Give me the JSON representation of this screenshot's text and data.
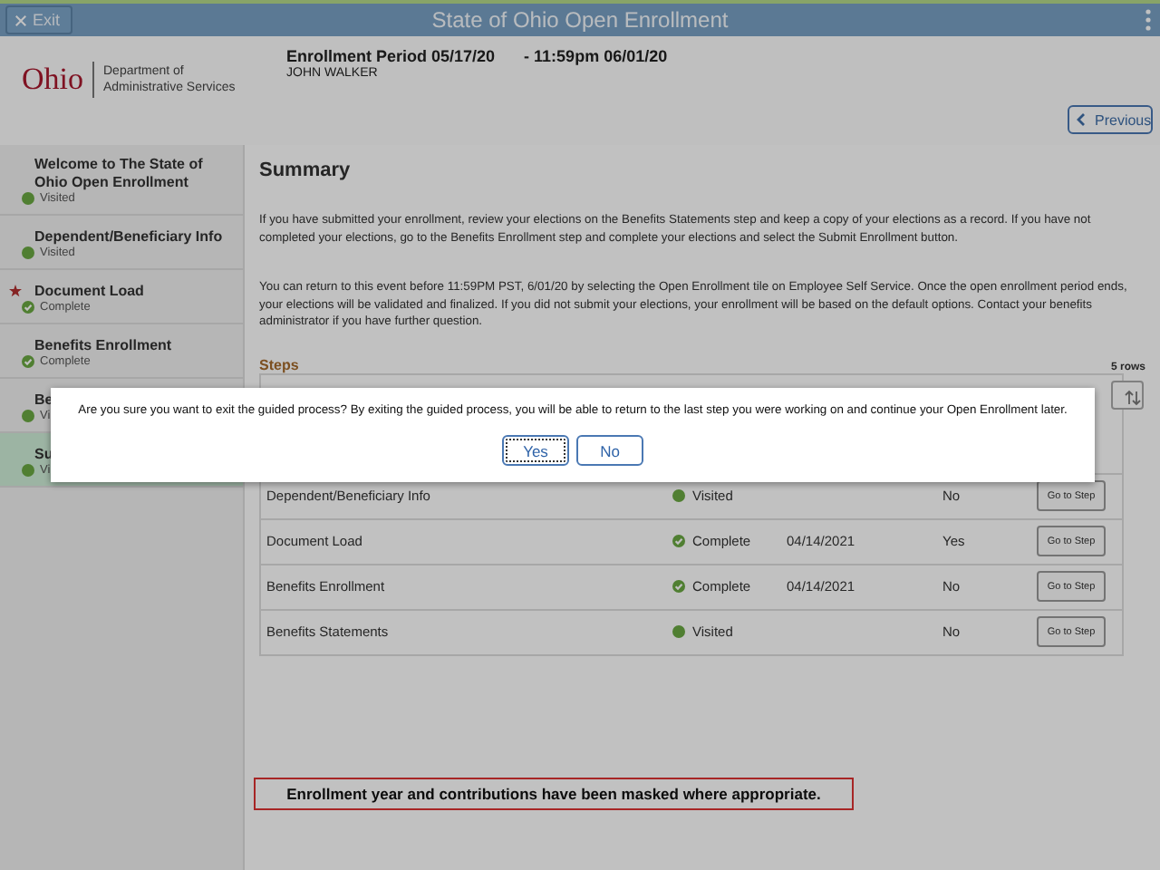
{
  "top_bar": {
    "exit_button": "Exit",
    "title": "State of Ohio Open Enrollment"
  },
  "logo": {
    "name": "Ohio",
    "department": "Department of Administrative Services"
  },
  "enrollment": {
    "period_start": "Enrollment Period 05/17/20",
    "period_end": "- 11:59pm 06/01/20",
    "employee": "JOHN WALKER"
  },
  "previous_button": "Previous",
  "sidebar": {
    "items": [
      {
        "label": "Welcome to The State of Ohio Open Enrollment",
        "status": "Visited",
        "kind": "visited",
        "required": false,
        "selected": false
      },
      {
        "label": "Dependent/Beneficiary Info",
        "status": "Visited",
        "kind": "visited",
        "required": false,
        "selected": false
      },
      {
        "label": "Document Load",
        "status": "Complete",
        "kind": "complete",
        "required": true,
        "selected": false
      },
      {
        "label": "Benefits Enrollment",
        "status": "Complete",
        "kind": "complete",
        "required": false,
        "selected": false
      },
      {
        "label": "Be",
        "status": "Vi",
        "kind": "visited",
        "required": false,
        "selected": false
      },
      {
        "label": "Su",
        "status": "Vi",
        "kind": "visited",
        "required": false,
        "selected": true
      }
    ]
  },
  "summary": {
    "title": "Summary",
    "paragraphs": [
      "If you have submitted your enrollment, review your elections on the Benefits Statements step and keep a copy of your elections as a record. If you have not completed your elections, go to the Benefits Enrollment step and complete your elections and select the Submit Enrollment button.",
      "You can return to this event before 11:59PM PST, 6/01/20 by selecting the Open Enrollment tile on Employee Self Service. Once the open enrollment period ends, your elections will be validated and finalized. If you did not submit your elections, your enrollment will be based on the default options.  Contact your benefits administrator if you have further question."
    ]
  },
  "steps": {
    "title": "Steps",
    "row_count": "5 rows",
    "rows": [
      {
        "step": "Dependent/Beneficiary Info",
        "status": "Visited",
        "kind": "visited",
        "required": "No",
        "button": "Go to Step"
      },
      {
        "step": "Document Load",
        "status": "Complete",
        "kind": "complete",
        "date": "04/14/2021",
        "required": "Yes",
        "button": "Go to Step"
      },
      {
        "step": "Benefits Enrollment",
        "status": "Complete",
        "kind": "complete",
        "date": "04/14/2021",
        "required": "No",
        "button": "Go to Step"
      },
      {
        "step": "Benefits Statements",
        "status": "Visited",
        "kind": "visited",
        "required": "No",
        "button": "Go to Step"
      }
    ]
  },
  "note": "Enrollment year and contributions have been masked where appropriate.",
  "dialog": {
    "message": "Are you sure you want to exit the guided process? By exiting the guided process, you will be able to return to the last step you were working on and continue your Open Enrollment later.",
    "buttons": [
      {
        "label": "Yes",
        "focused": true
      },
      {
        "label": "No",
        "focused": false
      }
    ]
  }
}
